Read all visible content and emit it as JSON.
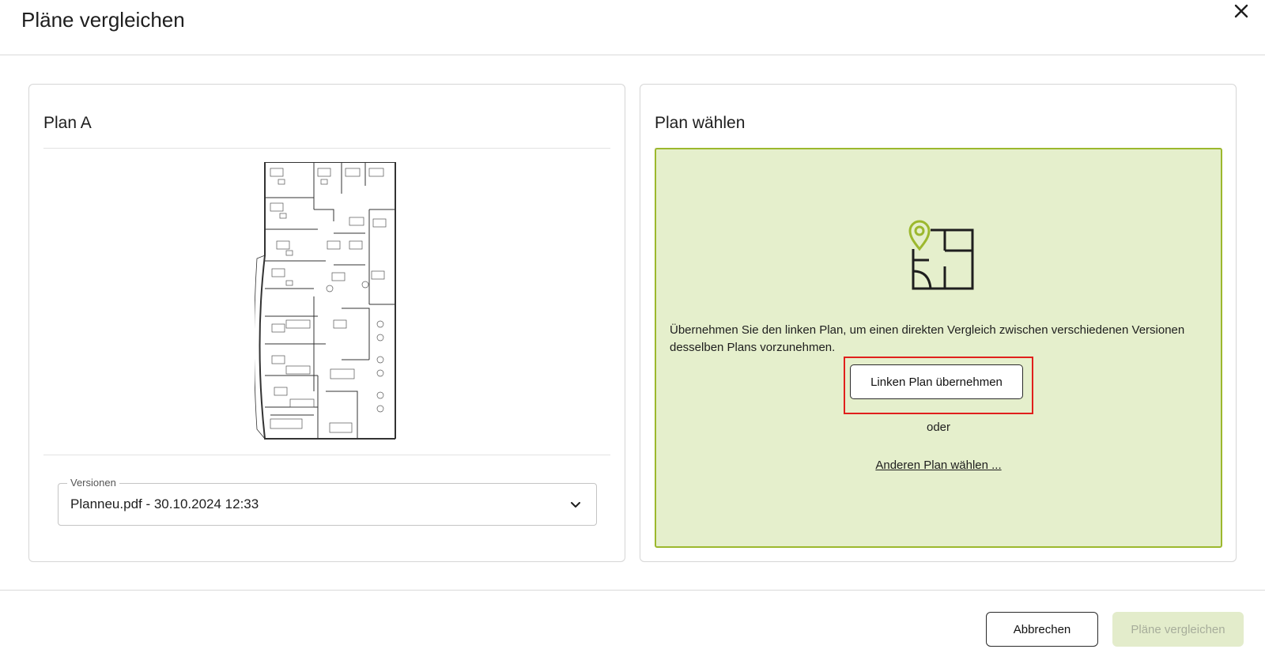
{
  "dialog": {
    "title": "Pläne vergleichen",
    "close_icon": "close-icon"
  },
  "left_panel": {
    "title": "Plan A",
    "versions": {
      "label": "Versionen",
      "selected": "Planneu.pdf - 30.10.2024 12:33",
      "chevron_icon": "chevron-down-icon"
    }
  },
  "right_panel": {
    "title": "Plan wählen",
    "icon": "floorplan-pin-icon",
    "description": "Übernehmen Sie den linken Plan, um einen direkten Vergleich zwischen verschiedenen Versionen desselben Plans vorzunehmen.",
    "take_button": "Linken Plan übernehmen",
    "or_text": "oder",
    "other_link": "Anderen Plan wählen ..."
  },
  "footer": {
    "cancel": "Abbrechen",
    "compare": "Pläne vergleichen"
  },
  "colors": {
    "accent_green": "#9cb82d",
    "dropzone_bg": "#e5efcc",
    "highlight_red": "#e0201c"
  }
}
